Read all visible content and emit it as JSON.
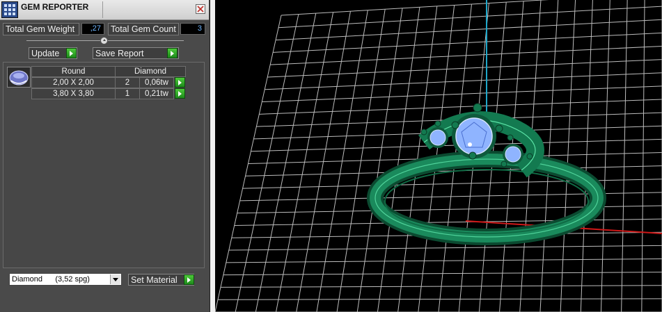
{
  "window": {
    "title": "GEM REPORTER"
  },
  "totals": {
    "weight_label": "Total Gem Weight",
    "weight_value": ",27",
    "count_label": "Total Gem Count",
    "count_value": "3"
  },
  "toolbar": {
    "update_label": "Update",
    "save_report_label": "Save Report"
  },
  "table": {
    "headers": [
      "Round",
      "Diamond"
    ],
    "rows": [
      {
        "size": "2,00 X 2,00",
        "count": "2",
        "weight": "0,06tw"
      },
      {
        "size": "3,80 X 3,80",
        "count": "1",
        "weight": "0,21tw"
      }
    ]
  },
  "material": {
    "selected": "Diamond      (3,52 spg)",
    "set_label": "Set Material"
  },
  "colors": {
    "panel_bg": "#4a4a4a",
    "value_text": "#6fb6ff",
    "go_button": "#2fa72a",
    "ring_metal": "#0e5a3c",
    "gem": "#8fb4ff",
    "grid": "#cfcfcf",
    "y_axis": "#1fa7c9",
    "x_axis": "#d01818"
  }
}
